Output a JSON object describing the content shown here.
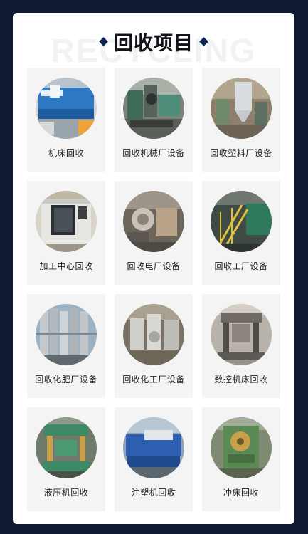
{
  "header": {
    "watermark": "RECYCLING",
    "title": "回收项目"
  },
  "items": [
    {
      "label": "机床回收",
      "icon": "press-brake-machine-photo"
    },
    {
      "label": "回收机械厂设备",
      "icon": "machinery-workshop-photo"
    },
    {
      "label": "回收塑料厂设备",
      "icon": "plastic-plant-silo-photo"
    },
    {
      "label": "加工中心回收",
      "icon": "machining-center-photo"
    },
    {
      "label": "回收电厂设备",
      "icon": "power-plant-equipment-photo"
    },
    {
      "label": "回收工厂设备",
      "icon": "factory-stairs-equipment-photo"
    },
    {
      "label": "回收化肥厂设备",
      "icon": "fertilizer-plant-tanks-photo"
    },
    {
      "label": "回收化工厂设备",
      "icon": "chemical-plant-vessels-photo"
    },
    {
      "label": "数控机床回收",
      "icon": "cnc-machine-photo"
    },
    {
      "label": "液压机回收",
      "icon": "hydraulic-press-photo"
    },
    {
      "label": "注塑机回收",
      "icon": "injection-molding-machine-photo"
    },
    {
      "label": "冲床回收",
      "icon": "punch-press-photo"
    }
  ]
}
